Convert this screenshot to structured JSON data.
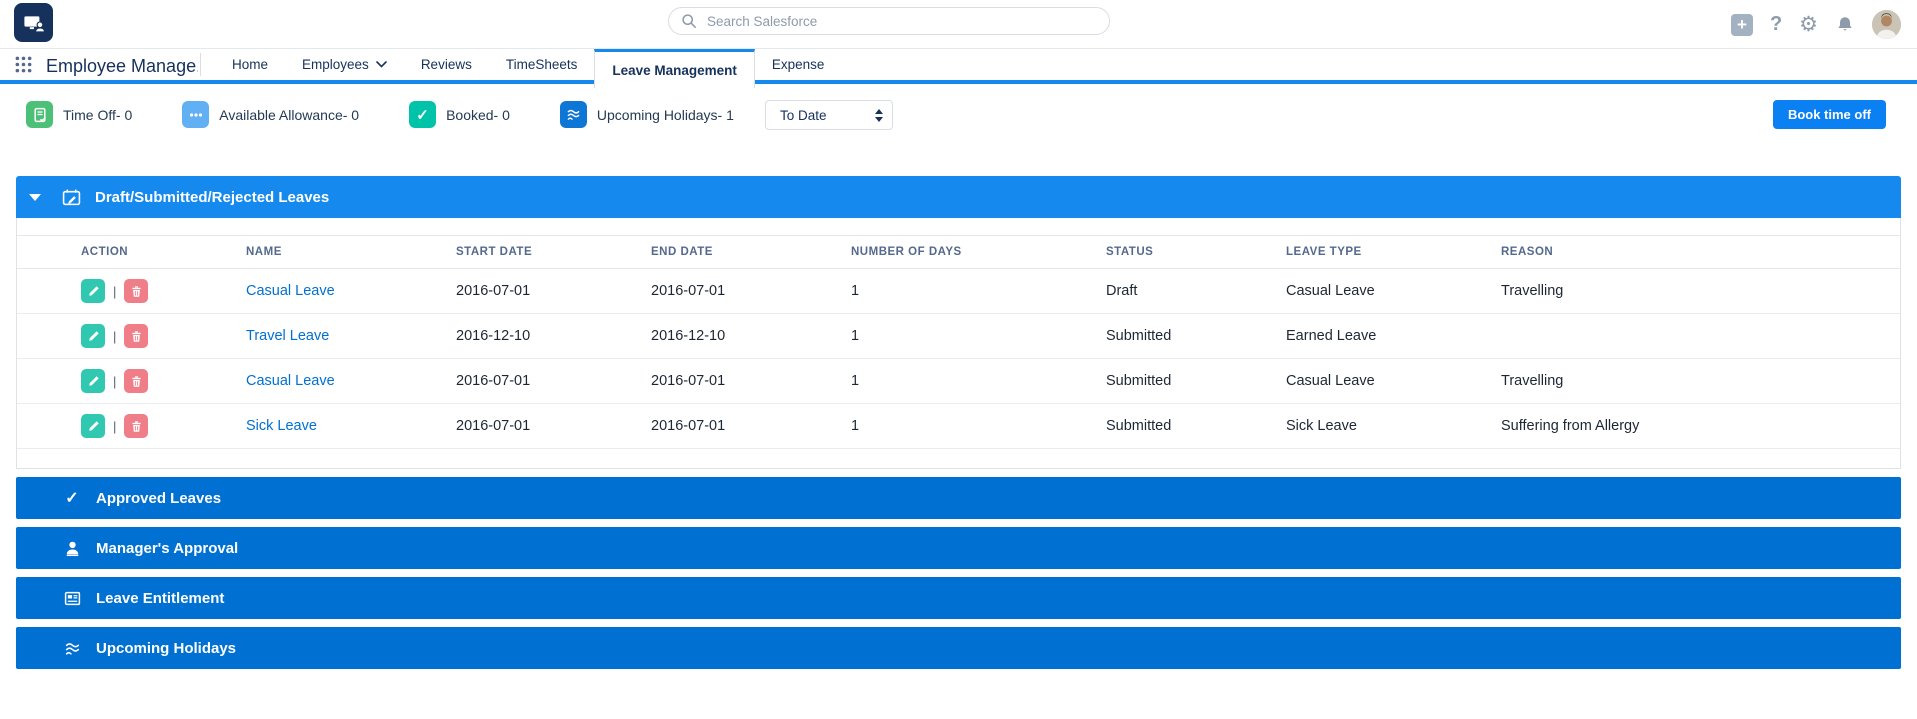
{
  "global_header": {
    "search": {
      "placeholder": "Search Salesforce"
    },
    "icons": {
      "plus": "+",
      "help": "?",
      "setup": "gear",
      "notifications": "bell",
      "profile": "avatar-photo"
    }
  },
  "app_nav": {
    "app_name": "Employee Manage...",
    "tabs": [
      {
        "label": "Home",
        "active": false
      },
      {
        "label": "Employees",
        "active": false,
        "has_dropdown": true
      },
      {
        "label": "Reviews",
        "active": false
      },
      {
        "label": "TimeSheets",
        "active": false
      },
      {
        "label": "Leave Management",
        "active": true
      },
      {
        "label": "Expense",
        "active": false
      }
    ]
  },
  "stats": {
    "items": [
      {
        "label": "Time Off- 0",
        "icon": "timeoff-doc-icon",
        "color": "#4bc076"
      },
      {
        "label": "Available Allowance- 0",
        "icon": "ellipsis-icon",
        "color": "#61b0f4"
      },
      {
        "label": "Booked- 0",
        "icon": "check-icon",
        "color": "#00c3a9"
      },
      {
        "label": "Upcoming Holidays- 1",
        "icon": "waves-icon",
        "color": "#0e76d4"
      }
    ],
    "date_filter_value": "To Date",
    "book_button_label": "Book time off"
  },
  "leaves": {
    "title": "Draft/Submitted/Rejected Leaves",
    "action_separator": "|",
    "columns": [
      "ACTION",
      "NAME",
      "START DATE",
      "END DATE",
      "NUMBER OF DAYS",
      "STATUS",
      "LEAVE TYPE",
      "REASON"
    ],
    "rows": [
      {
        "name": "Casual Leave",
        "start": "2016-07-01",
        "end": "2016-07-01",
        "days": "1",
        "status": "Draft",
        "type": "Casual Leave",
        "reason": "Travelling"
      },
      {
        "name": "Travel Leave",
        "start": "2016-12-10",
        "end": "2016-12-10",
        "days": "1",
        "status": "Submitted",
        "type": "Earned Leave",
        "reason": ""
      },
      {
        "name": "Casual Leave",
        "start": "2016-07-01",
        "end": "2016-07-01",
        "days": "1",
        "status": "Submitted",
        "type": "Casual Leave",
        "reason": "Travelling"
      },
      {
        "name": "Sick Leave",
        "start": "2016-07-01",
        "end": "2016-07-01",
        "days": "1",
        "status": "Submitted",
        "type": "Sick Leave",
        "reason": "Suffering from Allergy"
      }
    ]
  },
  "sections": [
    {
      "title": "Approved Leaves",
      "icon": "check-icon"
    },
    {
      "title": "Manager's Approval",
      "icon": "approver-person-icon"
    },
    {
      "title": "Leave Entitlement",
      "icon": "entitlement-list-icon"
    },
    {
      "title": "Upcoming Holidays",
      "icon": "waves-icon"
    }
  ],
  "colors": {
    "brand_navy": "#16325c",
    "accent_blue": "#1589ee",
    "bar_blue": "#0070d2",
    "button_blue": "#0b80f2",
    "link_blue": "#0070d2",
    "edit_teal": "#30c8b0",
    "delete_red": "#ef7e88"
  }
}
